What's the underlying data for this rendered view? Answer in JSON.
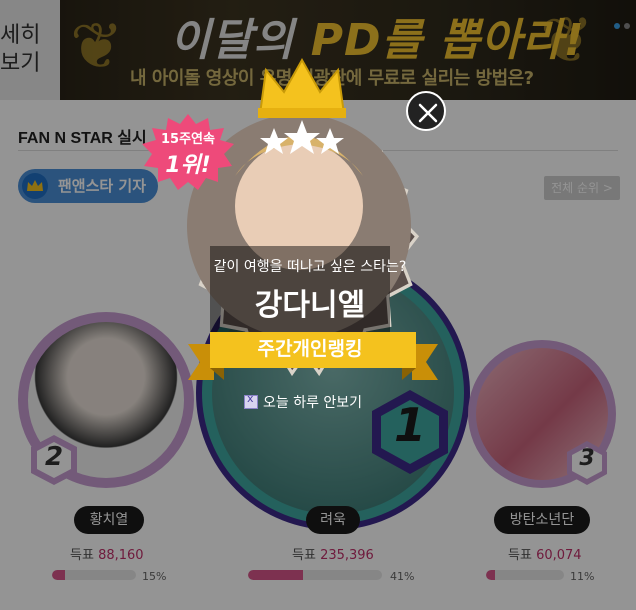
{
  "banner": {
    "left_text_line1": "세히",
    "left_text_line2": "보기",
    "title_part1": "이달의 ",
    "title_part2": "PD를 뽑아라!",
    "subtitle": "내 아이돌 영상이 유명 전광판에 무료로 실리는 방법은?",
    "indicator_colors": [
      "#3aa0e8",
      "#888888"
    ]
  },
  "section": {
    "title": "FAN N STAR 실시",
    "tab_label": "팬앤스타 기자",
    "all_rank_button": "전체 순위 >"
  },
  "ranking": [
    {
      "rank": "1",
      "name": "려욱",
      "votes_label": "득표",
      "votes": "235,396",
      "percent_label": "41%",
      "percent": 41,
      "ring_color": "#3ea7a0"
    },
    {
      "rank": "2",
      "name": "황치열",
      "votes_label": "득표",
      "votes": "88,160",
      "percent_label": "15%",
      "percent": 15,
      "ring_color": "#c79bd1"
    },
    {
      "rank": "3",
      "name": "방탄소년단",
      "votes_label": "득표",
      "votes": "60,074",
      "percent_label": "11%",
      "percent": 11,
      "ring_color": "#c79bd1"
    }
  ],
  "popup": {
    "streak_line1": "15주연속",
    "streak_line2": "1위!",
    "question": "같이 여행을 떠나고 싶은 스타는?",
    "star_name": "강다니엘",
    "ribbon_label": "주간개인랭킹",
    "dont_show_today": "오늘 하루 안보기",
    "accent_color": "#f4c21e",
    "burst_color": "#ee4a7a"
  },
  "icons": {
    "close": "close-icon",
    "crown": "crown-icon",
    "stars": "star-icon"
  }
}
